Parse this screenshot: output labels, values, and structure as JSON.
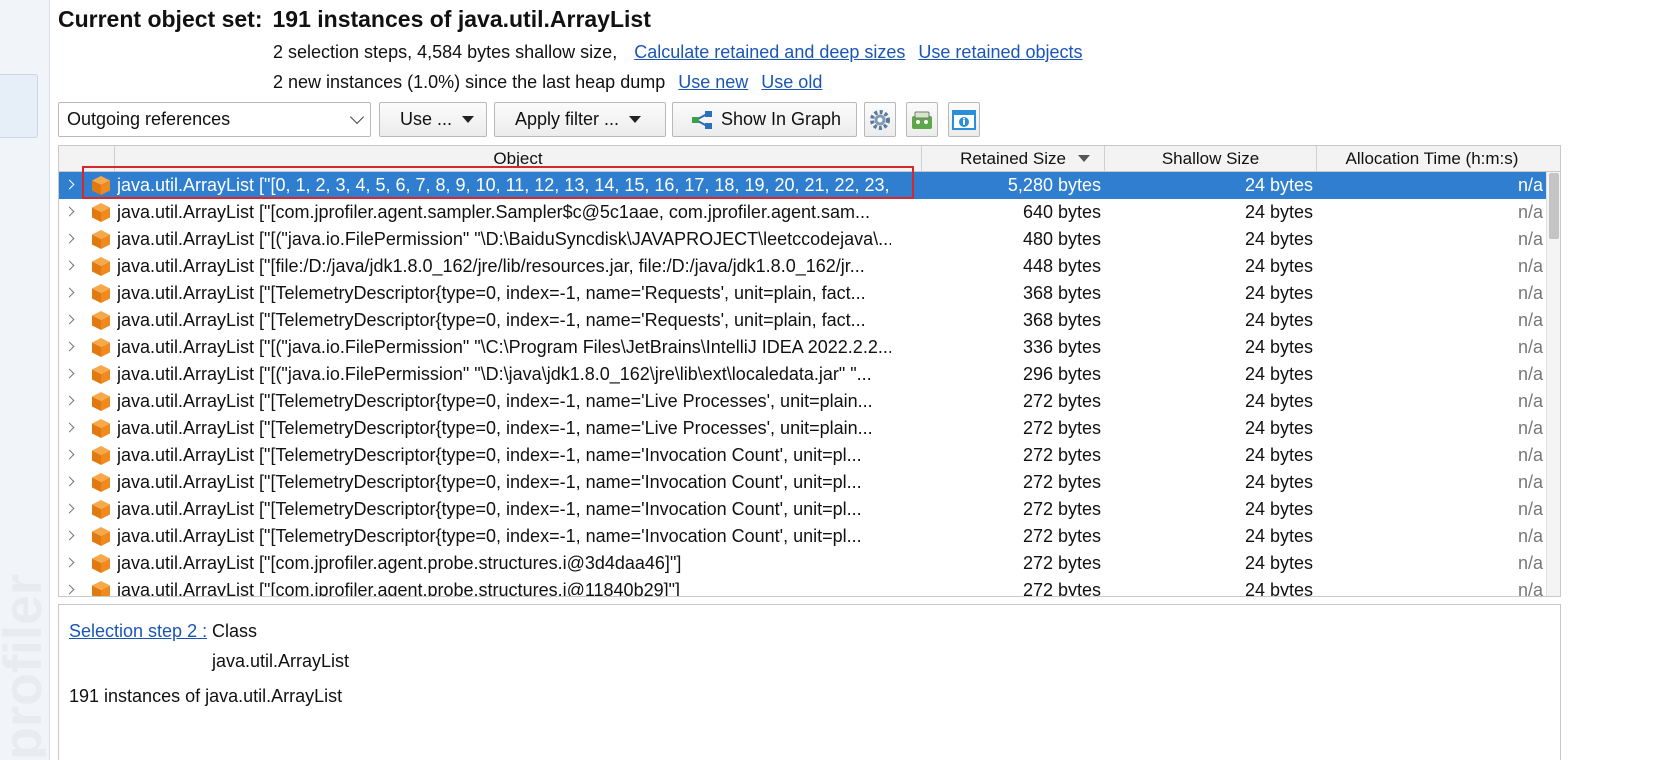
{
  "header": {
    "title_label": "Current object set:",
    "title_value": "191 instances of java.util.ArrayList",
    "line1_text": "2 selection steps, 4,584 bytes shallow size,",
    "line1_links": [
      "Calculate retained and deep sizes",
      "Use retained objects"
    ],
    "line2_text": "2 new instances (1.0%) since the last heap dump",
    "line2_links": [
      "Use new",
      "Use old"
    ]
  },
  "toolbar": {
    "view_select": "Outgoing references",
    "use_label": "Use ...",
    "filter_label": "Apply filter ...",
    "graph_label": "Show In Graph",
    "icons": [
      "settings-icon",
      "analysis-icon",
      "info-icon"
    ]
  },
  "table": {
    "columns": [
      "Object",
      "Retained Size",
      "Shallow Size",
      "Allocation Time (h:m:s)"
    ],
    "sorted_column": "Retained Size",
    "rows": [
      {
        "object": "java.util.ArrayList [\"[0, 1, 2, 3, 4, 5, 6, 7, 8, 9, 10, 11, 12, 13, 14, 15, 16, 17, 18, 19, 20, 21, 22, 23, 2.",
        "retained": "5,280 bytes",
        "shallow": "24 bytes",
        "alloc": "n/a",
        "selected": true
      },
      {
        "object": "java.util.ArrayList [\"[com.jprofiler.agent.sampler.Sampler$c@5c1aae, com.jprofiler.agent.sam...",
        "retained": "640 bytes",
        "shallow": "24 bytes",
        "alloc": "n/a"
      },
      {
        "object": "java.util.ArrayList [\"[(\"java.io.FilePermission\" \"\\D:\\BaiduSyncdisk\\JAVAPROJECT\\leetccodejava\\...",
        "retained": "480 bytes",
        "shallow": "24 bytes",
        "alloc": "n/a"
      },
      {
        "object": "java.util.ArrayList [\"[file:/D:/java/jdk1.8.0_162/jre/lib/resources.jar, file:/D:/java/jdk1.8.0_162/jr...",
        "retained": "448 bytes",
        "shallow": "24 bytes",
        "alloc": "n/a"
      },
      {
        "object": "java.util.ArrayList [\"[TelemetryDescriptor{type=0, index=-1, name='Requests', unit=plain, fact...",
        "retained": "368 bytes",
        "shallow": "24 bytes",
        "alloc": "n/a"
      },
      {
        "object": "java.util.ArrayList [\"[TelemetryDescriptor{type=0, index=-1, name='Requests', unit=plain, fact...",
        "retained": "368 bytes",
        "shallow": "24 bytes",
        "alloc": "n/a"
      },
      {
        "object": "java.util.ArrayList [\"[(\"java.io.FilePermission\" \"\\C:\\Program Files\\JetBrains\\IntelliJ IDEA 2022.2.2...",
        "retained": "336 bytes",
        "shallow": "24 bytes",
        "alloc": "n/a"
      },
      {
        "object": "java.util.ArrayList [\"[(\"java.io.FilePermission\" \"\\D:\\java\\jdk1.8.0_162\\jre\\lib\\ext\\localedata.jar\" \"...",
        "retained": "296 bytes",
        "shallow": "24 bytes",
        "alloc": "n/a"
      },
      {
        "object": "java.util.ArrayList [\"[TelemetryDescriptor{type=0, index=-1, name='Live Processes', unit=plain...",
        "retained": "272 bytes",
        "shallow": "24 bytes",
        "alloc": "n/a"
      },
      {
        "object": "java.util.ArrayList [\"[TelemetryDescriptor{type=0, index=-1, name='Live Processes', unit=plain...",
        "retained": "272 bytes",
        "shallow": "24 bytes",
        "alloc": "n/a"
      },
      {
        "object": "java.util.ArrayList [\"[TelemetryDescriptor{type=0, index=-1, name='Invocation Count', unit=pl...",
        "retained": "272 bytes",
        "shallow": "24 bytes",
        "alloc": "n/a"
      },
      {
        "object": "java.util.ArrayList [\"[TelemetryDescriptor{type=0, index=-1, name='Invocation Count', unit=pl...",
        "retained": "272 bytes",
        "shallow": "24 bytes",
        "alloc": "n/a"
      },
      {
        "object": "java.util.ArrayList [\"[TelemetryDescriptor{type=0, index=-1, name='Invocation Count', unit=pl...",
        "retained": "272 bytes",
        "shallow": "24 bytes",
        "alloc": "n/a"
      },
      {
        "object": "java.util.ArrayList [\"[TelemetryDescriptor{type=0, index=-1, name='Invocation Count', unit=pl...",
        "retained": "272 bytes",
        "shallow": "24 bytes",
        "alloc": "n/a"
      },
      {
        "object": "java.util.ArrayList [\"[com.jprofiler.agent.probe.structures.i@3d4daa46]\"]",
        "retained": "272 bytes",
        "shallow": "24 bytes",
        "alloc": "n/a"
      },
      {
        "object": "java.util.ArrayList [\"[com.jprofiler.agent.probe.structures.i@11840b29]\"]",
        "retained": "272 bytes",
        "shallow": "24 bytes",
        "alloc": "n/a"
      }
    ]
  },
  "detail": {
    "step_link": "Selection step 2 :",
    "step_type": "Class",
    "step_class": "java.util.ArrayList",
    "summary": "191 instances of java.util.ArrayList"
  },
  "colors": {
    "selection": "#2f7ed0",
    "link": "#1a56b5",
    "instance_icon": "#f08a1c",
    "highlight_outline": "#d9272e"
  }
}
